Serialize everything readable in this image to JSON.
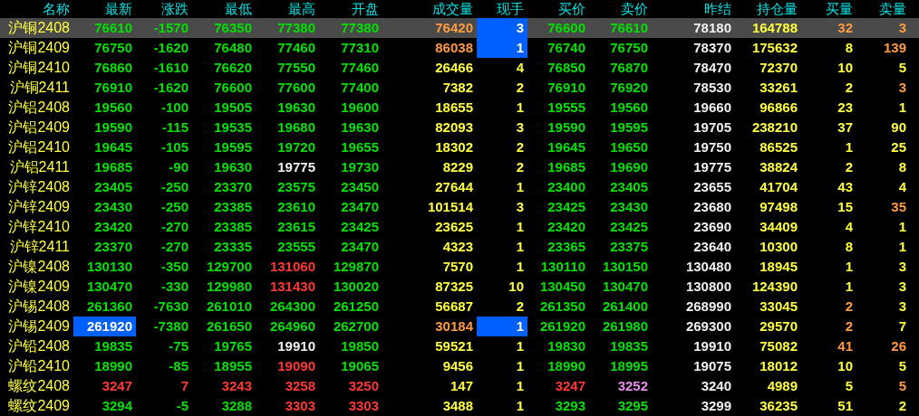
{
  "columns": [
    "名称",
    "最新",
    "涨跌",
    "最低",
    "最高",
    "开盘",
    "成交量",
    "现手",
    "买价",
    "卖价",
    "昨结",
    "持仓量",
    "买量",
    "卖量"
  ],
  "rows": [
    {
      "name": "沪铜2408",
      "selected": true,
      "cells": [
        {
          "text": "76610",
          "color": "#00e000",
          "highlighted": false
        },
        {
          "text": "-1570",
          "color": "#00e000",
          "highlighted": false
        },
        {
          "text": "76350",
          "color": "#00e000",
          "highlighted": false
        },
        {
          "text": "77380",
          "color": "#00e000",
          "highlighted": false
        },
        {
          "text": "77380",
          "color": "#00e000",
          "highlighted": false
        },
        {
          "text": "76420",
          "color": "#ff9a40",
          "highlighted": false
        },
        {
          "text": "3",
          "color": "#ffffff",
          "highlighted": true
        },
        {
          "text": "76600",
          "color": "#00e000",
          "highlighted": false
        },
        {
          "text": "76610",
          "color": "#00e000",
          "highlighted": false
        },
        {
          "text": "78180",
          "color": "#f0f0f0",
          "highlighted": false
        },
        {
          "text": "164788",
          "color": "#ffff40",
          "highlighted": false
        },
        {
          "text": "32",
          "color": "#ff9a40",
          "highlighted": false
        },
        {
          "text": "3",
          "color": "#ff9a40",
          "highlighted": false
        }
      ]
    },
    {
      "name": "沪铜2409",
      "selected": false,
      "cells": [
        {
          "text": "76750",
          "color": "#00e000",
          "highlighted": false
        },
        {
          "text": "-1620",
          "color": "#00e000",
          "highlighted": false
        },
        {
          "text": "76480",
          "color": "#00e000",
          "highlighted": false
        },
        {
          "text": "77460",
          "color": "#00e000",
          "highlighted": false
        },
        {
          "text": "77310",
          "color": "#00e000",
          "highlighted": false
        },
        {
          "text": "86038",
          "color": "#ff9a40",
          "highlighted": false
        },
        {
          "text": "1",
          "color": "#ffffff",
          "highlighted": true
        },
        {
          "text": "76740",
          "color": "#00e000",
          "highlighted": false
        },
        {
          "text": "76750",
          "color": "#00e000",
          "highlighted": false
        },
        {
          "text": "78370",
          "color": "#f0f0f0",
          "highlighted": false
        },
        {
          "text": "175632",
          "color": "#ffff40",
          "highlighted": false
        },
        {
          "text": "8",
          "color": "#ffff40",
          "highlighted": false
        },
        {
          "text": "139",
          "color": "#ff9a40",
          "highlighted": false
        }
      ]
    },
    {
      "name": "沪铜2410",
      "selected": false,
      "cells": [
        {
          "text": "76860",
          "color": "#00e000",
          "highlighted": false
        },
        {
          "text": "-1610",
          "color": "#00e000",
          "highlighted": false
        },
        {
          "text": "76620",
          "color": "#00e000",
          "highlighted": false
        },
        {
          "text": "77550",
          "color": "#00e000",
          "highlighted": false
        },
        {
          "text": "77460",
          "color": "#00e000",
          "highlighted": false
        },
        {
          "text": "26466",
          "color": "#ffff40",
          "highlighted": false
        },
        {
          "text": "4",
          "color": "#ffff40",
          "highlighted": false
        },
        {
          "text": "76850",
          "color": "#00e000",
          "highlighted": false
        },
        {
          "text": "76870",
          "color": "#00e000",
          "highlighted": false
        },
        {
          "text": "78470",
          "color": "#f0f0f0",
          "highlighted": false
        },
        {
          "text": "72370",
          "color": "#ffff40",
          "highlighted": false
        },
        {
          "text": "10",
          "color": "#ffff40",
          "highlighted": false
        },
        {
          "text": "5",
          "color": "#ffff40",
          "highlighted": false
        }
      ]
    },
    {
      "name": "沪铜2411",
      "selected": false,
      "cells": [
        {
          "text": "76910",
          "color": "#00e000",
          "highlighted": false
        },
        {
          "text": "-1620",
          "color": "#00e000",
          "highlighted": false
        },
        {
          "text": "76600",
          "color": "#00e000",
          "highlighted": false
        },
        {
          "text": "77600",
          "color": "#00e000",
          "highlighted": false
        },
        {
          "text": "77400",
          "color": "#00e000",
          "highlighted": false
        },
        {
          "text": "7382",
          "color": "#ffff40",
          "highlighted": false
        },
        {
          "text": "2",
          "color": "#ffff40",
          "highlighted": false
        },
        {
          "text": "76910",
          "color": "#00e000",
          "highlighted": false
        },
        {
          "text": "76920",
          "color": "#00e000",
          "highlighted": false
        },
        {
          "text": "78530",
          "color": "#f0f0f0",
          "highlighted": false
        },
        {
          "text": "33261",
          "color": "#ffff40",
          "highlighted": false
        },
        {
          "text": "2",
          "color": "#ffff40",
          "highlighted": false
        },
        {
          "text": "3",
          "color": "#ff9a40",
          "highlighted": false
        }
      ]
    },
    {
      "name": "沪铝2408",
      "selected": false,
      "cells": [
        {
          "text": "19560",
          "color": "#00e000",
          "highlighted": false
        },
        {
          "text": "-100",
          "color": "#00e000",
          "highlighted": false
        },
        {
          "text": "19505",
          "color": "#00e000",
          "highlighted": false
        },
        {
          "text": "19630",
          "color": "#00e000",
          "highlighted": false
        },
        {
          "text": "19600",
          "color": "#00e000",
          "highlighted": false
        },
        {
          "text": "18655",
          "color": "#ffff40",
          "highlighted": false
        },
        {
          "text": "1",
          "color": "#ffff40",
          "highlighted": false
        },
        {
          "text": "19555",
          "color": "#00e000",
          "highlighted": false
        },
        {
          "text": "19560",
          "color": "#00e000",
          "highlighted": false
        },
        {
          "text": "19660",
          "color": "#f0f0f0",
          "highlighted": false
        },
        {
          "text": "96866",
          "color": "#ffff40",
          "highlighted": false
        },
        {
          "text": "23",
          "color": "#ffff40",
          "highlighted": false
        },
        {
          "text": "1",
          "color": "#ffff40",
          "highlighted": false
        }
      ]
    },
    {
      "name": "沪铝2409",
      "selected": false,
      "cells": [
        {
          "text": "19590",
          "color": "#00e000",
          "highlighted": false
        },
        {
          "text": "-115",
          "color": "#00e000",
          "highlighted": false
        },
        {
          "text": "19535",
          "color": "#00e000",
          "highlighted": false
        },
        {
          "text": "19680",
          "color": "#00e000",
          "highlighted": false
        },
        {
          "text": "19630",
          "color": "#00e000",
          "highlighted": false
        },
        {
          "text": "82093",
          "color": "#ffff40",
          "highlighted": false
        },
        {
          "text": "3",
          "color": "#ffff40",
          "highlighted": false
        },
        {
          "text": "19590",
          "color": "#00e000",
          "highlighted": false
        },
        {
          "text": "19595",
          "color": "#00e000",
          "highlighted": false
        },
        {
          "text": "19705",
          "color": "#f0f0f0",
          "highlighted": false
        },
        {
          "text": "238210",
          "color": "#ffff40",
          "highlighted": false
        },
        {
          "text": "37",
          "color": "#ffff40",
          "highlighted": false
        },
        {
          "text": "90",
          "color": "#ffff40",
          "highlighted": false
        }
      ]
    },
    {
      "name": "沪铝2410",
      "selected": false,
      "cells": [
        {
          "text": "19645",
          "color": "#00e000",
          "highlighted": false
        },
        {
          "text": "-105",
          "color": "#00e000",
          "highlighted": false
        },
        {
          "text": "19595",
          "color": "#00e000",
          "highlighted": false
        },
        {
          "text": "19720",
          "color": "#00e000",
          "highlighted": false
        },
        {
          "text": "19655",
          "color": "#00e000",
          "highlighted": false
        },
        {
          "text": "18302",
          "color": "#ffff40",
          "highlighted": false
        },
        {
          "text": "2",
          "color": "#ffff40",
          "highlighted": false
        },
        {
          "text": "19645",
          "color": "#00e000",
          "highlighted": false
        },
        {
          "text": "19650",
          "color": "#00e000",
          "highlighted": false
        },
        {
          "text": "19750",
          "color": "#f0f0f0",
          "highlighted": false
        },
        {
          "text": "86525",
          "color": "#ffff40",
          "highlighted": false
        },
        {
          "text": "1",
          "color": "#ffff40",
          "highlighted": false
        },
        {
          "text": "25",
          "color": "#ffff40",
          "highlighted": false
        }
      ]
    },
    {
      "name": "沪铝2411",
      "selected": false,
      "cells": [
        {
          "text": "19685",
          "color": "#00e000",
          "highlighted": false
        },
        {
          "text": "-90",
          "color": "#00e000",
          "highlighted": false
        },
        {
          "text": "19630",
          "color": "#00e000",
          "highlighted": false
        },
        {
          "text": "19775",
          "color": "#f0f0f0",
          "highlighted": false
        },
        {
          "text": "19730",
          "color": "#00e000",
          "highlighted": false
        },
        {
          "text": "8229",
          "color": "#ffff40",
          "highlighted": false
        },
        {
          "text": "2",
          "color": "#ffff40",
          "highlighted": false
        },
        {
          "text": "19685",
          "color": "#00e000",
          "highlighted": false
        },
        {
          "text": "19690",
          "color": "#00e000",
          "highlighted": false
        },
        {
          "text": "19775",
          "color": "#f0f0f0",
          "highlighted": false
        },
        {
          "text": "38824",
          "color": "#ffff40",
          "highlighted": false
        },
        {
          "text": "2",
          "color": "#ffff40",
          "highlighted": false
        },
        {
          "text": "8",
          "color": "#ffff40",
          "highlighted": false
        }
      ]
    },
    {
      "name": "沪锌2408",
      "selected": false,
      "cells": [
        {
          "text": "23405",
          "color": "#00e000",
          "highlighted": false
        },
        {
          "text": "-250",
          "color": "#00e000",
          "highlighted": false
        },
        {
          "text": "23370",
          "color": "#00e000",
          "highlighted": false
        },
        {
          "text": "23575",
          "color": "#00e000",
          "highlighted": false
        },
        {
          "text": "23450",
          "color": "#00e000",
          "highlighted": false
        },
        {
          "text": "27644",
          "color": "#ffff40",
          "highlighted": false
        },
        {
          "text": "1",
          "color": "#ffff40",
          "highlighted": false
        },
        {
          "text": "23400",
          "color": "#00e000",
          "highlighted": false
        },
        {
          "text": "23405",
          "color": "#00e000",
          "highlighted": false
        },
        {
          "text": "23655",
          "color": "#f0f0f0",
          "highlighted": false
        },
        {
          "text": "41704",
          "color": "#ffff40",
          "highlighted": false
        },
        {
          "text": "43",
          "color": "#ffff40",
          "highlighted": false
        },
        {
          "text": "4",
          "color": "#ffff40",
          "highlighted": false
        }
      ]
    },
    {
      "name": "沪锌2409",
      "selected": false,
      "cells": [
        {
          "text": "23430",
          "color": "#00e000",
          "highlighted": false
        },
        {
          "text": "-250",
          "color": "#00e000",
          "highlighted": false
        },
        {
          "text": "23385",
          "color": "#00e000",
          "highlighted": false
        },
        {
          "text": "23610",
          "color": "#00e000",
          "highlighted": false
        },
        {
          "text": "23470",
          "color": "#00e000",
          "highlighted": false
        },
        {
          "text": "101514",
          "color": "#ffff40",
          "highlighted": false
        },
        {
          "text": "3",
          "color": "#ffff40",
          "highlighted": false
        },
        {
          "text": "23425",
          "color": "#00e000",
          "highlighted": false
        },
        {
          "text": "23430",
          "color": "#00e000",
          "highlighted": false
        },
        {
          "text": "23680",
          "color": "#f0f0f0",
          "highlighted": false
        },
        {
          "text": "97498",
          "color": "#ffff40",
          "highlighted": false
        },
        {
          "text": "15",
          "color": "#ffff40",
          "highlighted": false
        },
        {
          "text": "35",
          "color": "#ff9a40",
          "highlighted": false
        }
      ]
    },
    {
      "name": "沪锌2410",
      "selected": false,
      "cells": [
        {
          "text": "23420",
          "color": "#00e000",
          "highlighted": false
        },
        {
          "text": "-270",
          "color": "#00e000",
          "highlighted": false
        },
        {
          "text": "23385",
          "color": "#00e000",
          "highlighted": false
        },
        {
          "text": "23615",
          "color": "#00e000",
          "highlighted": false
        },
        {
          "text": "23425",
          "color": "#00e000",
          "highlighted": false
        },
        {
          "text": "23625",
          "color": "#ffff40",
          "highlighted": false
        },
        {
          "text": "1",
          "color": "#ffff40",
          "highlighted": false
        },
        {
          "text": "23420",
          "color": "#00e000",
          "highlighted": false
        },
        {
          "text": "23425",
          "color": "#00e000",
          "highlighted": false
        },
        {
          "text": "23690",
          "color": "#f0f0f0",
          "highlighted": false
        },
        {
          "text": "34409",
          "color": "#ffff40",
          "highlighted": false
        },
        {
          "text": "4",
          "color": "#ffff40",
          "highlighted": false
        },
        {
          "text": "1",
          "color": "#ffff40",
          "highlighted": false
        }
      ]
    },
    {
      "name": "沪锌2411",
      "selected": false,
      "cells": [
        {
          "text": "23370",
          "color": "#00e000",
          "highlighted": false
        },
        {
          "text": "-270",
          "color": "#00e000",
          "highlighted": false
        },
        {
          "text": "23335",
          "color": "#00e000",
          "highlighted": false
        },
        {
          "text": "23555",
          "color": "#00e000",
          "highlighted": false
        },
        {
          "text": "23470",
          "color": "#00e000",
          "highlighted": false
        },
        {
          "text": "4323",
          "color": "#ffff40",
          "highlighted": false
        },
        {
          "text": "1",
          "color": "#ffff40",
          "highlighted": false
        },
        {
          "text": "23365",
          "color": "#00e000",
          "highlighted": false
        },
        {
          "text": "23375",
          "color": "#00e000",
          "highlighted": false
        },
        {
          "text": "23640",
          "color": "#f0f0f0",
          "highlighted": false
        },
        {
          "text": "10300",
          "color": "#ffff40",
          "highlighted": false
        },
        {
          "text": "8",
          "color": "#ffff40",
          "highlighted": false
        },
        {
          "text": "1",
          "color": "#ffff40",
          "highlighted": false
        }
      ]
    },
    {
      "name": "沪镍2408",
      "selected": false,
      "cells": [
        {
          "text": "130130",
          "color": "#00e000",
          "highlighted": false
        },
        {
          "text": "-350",
          "color": "#00e000",
          "highlighted": false
        },
        {
          "text": "129700",
          "color": "#00e000",
          "highlighted": false
        },
        {
          "text": "131060",
          "color": "#ff3838",
          "highlighted": false
        },
        {
          "text": "129870",
          "color": "#00e000",
          "highlighted": false
        },
        {
          "text": "7570",
          "color": "#ffff40",
          "highlighted": false
        },
        {
          "text": "1",
          "color": "#ffff40",
          "highlighted": false
        },
        {
          "text": "130110",
          "color": "#00e000",
          "highlighted": false
        },
        {
          "text": "130150",
          "color": "#00e000",
          "highlighted": false
        },
        {
          "text": "130480",
          "color": "#f0f0f0",
          "highlighted": false
        },
        {
          "text": "18945",
          "color": "#ffff40",
          "highlighted": false
        },
        {
          "text": "1",
          "color": "#ffff40",
          "highlighted": false
        },
        {
          "text": "3",
          "color": "#ffff40",
          "highlighted": false
        }
      ]
    },
    {
      "name": "沪镍2409",
      "selected": false,
      "cells": [
        {
          "text": "130470",
          "color": "#00e000",
          "highlighted": false
        },
        {
          "text": "-330",
          "color": "#00e000",
          "highlighted": false
        },
        {
          "text": "129980",
          "color": "#00e000",
          "highlighted": false
        },
        {
          "text": "131430",
          "color": "#ff3838",
          "highlighted": false
        },
        {
          "text": "130020",
          "color": "#00e000",
          "highlighted": false
        },
        {
          "text": "87325",
          "color": "#ffff40",
          "highlighted": false
        },
        {
          "text": "10",
          "color": "#ffff40",
          "highlighted": false
        },
        {
          "text": "130450",
          "color": "#00e000",
          "highlighted": false
        },
        {
          "text": "130470",
          "color": "#00e000",
          "highlighted": false
        },
        {
          "text": "130800",
          "color": "#f0f0f0",
          "highlighted": false
        },
        {
          "text": "124390",
          "color": "#ffff40",
          "highlighted": false
        },
        {
          "text": "1",
          "color": "#ffff40",
          "highlighted": false
        },
        {
          "text": "3",
          "color": "#ffff40",
          "highlighted": false
        }
      ]
    },
    {
      "name": "沪锡2408",
      "selected": false,
      "cells": [
        {
          "text": "261360",
          "color": "#00e000",
          "highlighted": false
        },
        {
          "text": "-7630",
          "color": "#00e000",
          "highlighted": false
        },
        {
          "text": "261010",
          "color": "#00e000",
          "highlighted": false
        },
        {
          "text": "264300",
          "color": "#00e000",
          "highlighted": false
        },
        {
          "text": "261250",
          "color": "#00e000",
          "highlighted": false
        },
        {
          "text": "56687",
          "color": "#ffff40",
          "highlighted": false
        },
        {
          "text": "2",
          "color": "#ffff40",
          "highlighted": false
        },
        {
          "text": "261350",
          "color": "#00e000",
          "highlighted": false
        },
        {
          "text": "261400",
          "color": "#00e000",
          "highlighted": false
        },
        {
          "text": "268990",
          "color": "#f0f0f0",
          "highlighted": false
        },
        {
          "text": "33045",
          "color": "#ffff40",
          "highlighted": false
        },
        {
          "text": "2",
          "color": "#ff9a40",
          "highlighted": false
        },
        {
          "text": "3",
          "color": "#ffff40",
          "highlighted": false
        }
      ]
    },
    {
      "name": "沪锡2409",
      "selected": false,
      "cells": [
        {
          "text": "261920",
          "color": "#ffffff",
          "highlighted": true
        },
        {
          "text": "-7380",
          "color": "#00e000",
          "highlighted": false
        },
        {
          "text": "261650",
          "color": "#00e000",
          "highlighted": false
        },
        {
          "text": "264960",
          "color": "#00e000",
          "highlighted": false
        },
        {
          "text": "262700",
          "color": "#00e000",
          "highlighted": false
        },
        {
          "text": "30184",
          "color": "#ff9a40",
          "highlighted": false
        },
        {
          "text": "1",
          "color": "#ffffff",
          "highlighted": true
        },
        {
          "text": "261920",
          "color": "#00e000",
          "highlighted": false
        },
        {
          "text": "261980",
          "color": "#00e000",
          "highlighted": false
        },
        {
          "text": "269300",
          "color": "#f0f0f0",
          "highlighted": false
        },
        {
          "text": "29570",
          "color": "#ffff40",
          "highlighted": false
        },
        {
          "text": "2",
          "color": "#ff9a40",
          "highlighted": false
        },
        {
          "text": "7",
          "color": "#ffff40",
          "highlighted": false
        }
      ]
    },
    {
      "name": "沪铅2408",
      "selected": false,
      "cells": [
        {
          "text": "19835",
          "color": "#00e000",
          "highlighted": false
        },
        {
          "text": "-75",
          "color": "#00e000",
          "highlighted": false
        },
        {
          "text": "19765",
          "color": "#00e000",
          "highlighted": false
        },
        {
          "text": "19910",
          "color": "#f0f0f0",
          "highlighted": false
        },
        {
          "text": "19850",
          "color": "#00e000",
          "highlighted": false
        },
        {
          "text": "59521",
          "color": "#ffff40",
          "highlighted": false
        },
        {
          "text": "1",
          "color": "#ffff40",
          "highlighted": false
        },
        {
          "text": "19830",
          "color": "#00e000",
          "highlighted": false
        },
        {
          "text": "19835",
          "color": "#00e000",
          "highlighted": false
        },
        {
          "text": "19910",
          "color": "#f0f0f0",
          "highlighted": false
        },
        {
          "text": "75082",
          "color": "#ffff40",
          "highlighted": false
        },
        {
          "text": "41",
          "color": "#ff9a40",
          "highlighted": false
        },
        {
          "text": "26",
          "color": "#ff9a40",
          "highlighted": false
        }
      ]
    },
    {
      "name": "沪铅2410",
      "selected": false,
      "cells": [
        {
          "text": "18990",
          "color": "#00e000",
          "highlighted": false
        },
        {
          "text": "-85",
          "color": "#00e000",
          "highlighted": false
        },
        {
          "text": "18955",
          "color": "#00e000",
          "highlighted": false
        },
        {
          "text": "19090",
          "color": "#ff3838",
          "highlighted": false
        },
        {
          "text": "19065",
          "color": "#00e000",
          "highlighted": false
        },
        {
          "text": "9456",
          "color": "#ffff40",
          "highlighted": false
        },
        {
          "text": "1",
          "color": "#ffff40",
          "highlighted": false
        },
        {
          "text": "18990",
          "color": "#00e000",
          "highlighted": false
        },
        {
          "text": "18995",
          "color": "#00e000",
          "highlighted": false
        },
        {
          "text": "19075",
          "color": "#f0f0f0",
          "highlighted": false
        },
        {
          "text": "18012",
          "color": "#ffff40",
          "highlighted": false
        },
        {
          "text": "10",
          "color": "#ffff40",
          "highlighted": false
        },
        {
          "text": "5",
          "color": "#ffff40",
          "highlighted": false
        }
      ]
    },
    {
      "name": "螺纹2408",
      "selected": false,
      "cells": [
        {
          "text": "3247",
          "color": "#ff3838",
          "highlighted": false
        },
        {
          "text": "7",
          "color": "#ff3838",
          "highlighted": false
        },
        {
          "text": "3243",
          "color": "#ff3838",
          "highlighted": false
        },
        {
          "text": "3258",
          "color": "#ff3838",
          "highlighted": false
        },
        {
          "text": "3250",
          "color": "#ff3838",
          "highlighted": false
        },
        {
          "text": "147",
          "color": "#ffff40",
          "highlighted": false
        },
        {
          "text": "1",
          "color": "#ffff40",
          "highlighted": false
        },
        {
          "text": "3247",
          "color": "#ff3838",
          "highlighted": false
        },
        {
          "text": "3252",
          "color": "#e890e8",
          "highlighted": false
        },
        {
          "text": "3240",
          "color": "#f0f0f0",
          "highlighted": false
        },
        {
          "text": "4989",
          "color": "#ffff40",
          "highlighted": false
        },
        {
          "text": "5",
          "color": "#ffff40",
          "highlighted": false
        },
        {
          "text": "5",
          "color": "#ff9a40",
          "highlighted": false
        }
      ]
    },
    {
      "name": "螺纹2409",
      "selected": false,
      "cells": [
        {
          "text": "3294",
          "color": "#00e000",
          "highlighted": false
        },
        {
          "text": "-5",
          "color": "#00e000",
          "highlighted": false
        },
        {
          "text": "3288",
          "color": "#00e000",
          "highlighted": false
        },
        {
          "text": "3303",
          "color": "#ff3838",
          "highlighted": false
        },
        {
          "text": "3303",
          "color": "#ff3838",
          "highlighted": false
        },
        {
          "text": "3488",
          "color": "#ffff40",
          "highlighted": false
        },
        {
          "text": "1",
          "color": "#ffff40",
          "highlighted": false
        },
        {
          "text": "3293",
          "color": "#00e000",
          "highlighted": false
        },
        {
          "text": "3295",
          "color": "#00e000",
          "highlighted": false
        },
        {
          "text": "3299",
          "color": "#f0f0f0",
          "highlighted": false
        },
        {
          "text": "36235",
          "color": "#ffff40",
          "highlighted": false
        },
        {
          "text": "51",
          "color": "#ffff40",
          "highlighted": false
        },
        {
          "text": "2",
          "color": "#ffff40",
          "highlighted": false
        }
      ]
    }
  ]
}
